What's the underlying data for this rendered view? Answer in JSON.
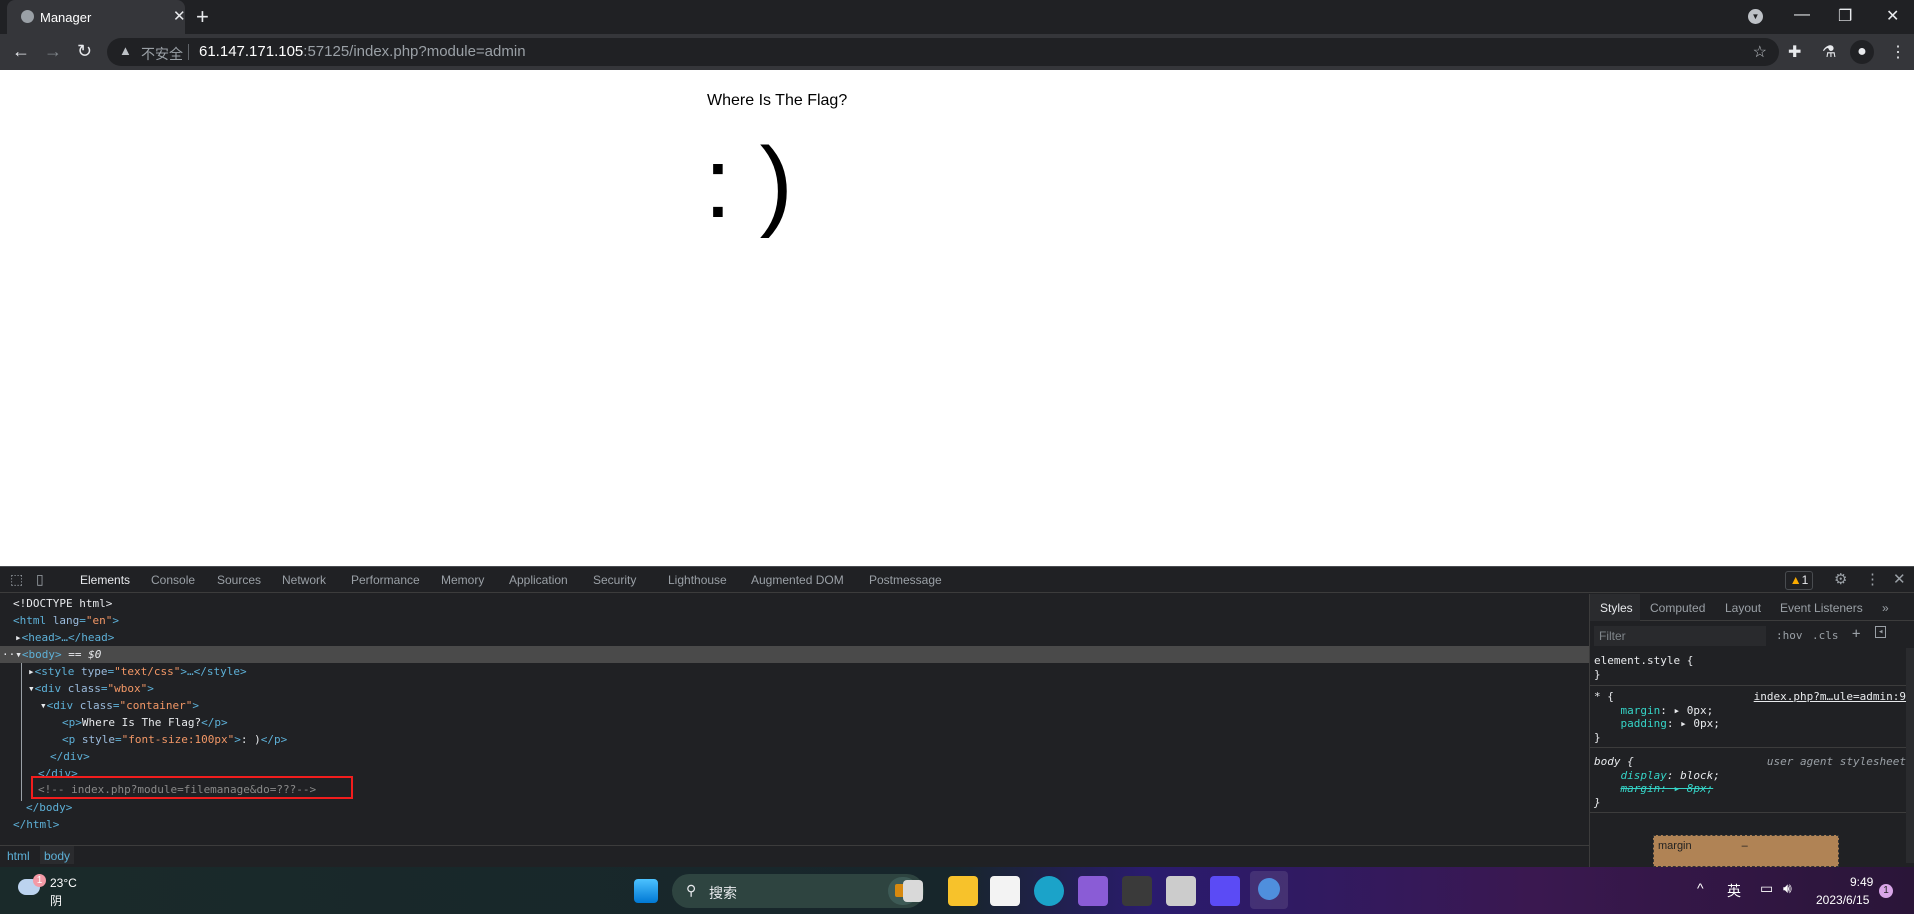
{
  "browser": {
    "tab_title": "Manager",
    "insecure_label": "不安全",
    "url_host": "61.147.171.105",
    "url_rest": ":57125/index.php?module=admin"
  },
  "page": {
    "heading": "Where Is The Flag?",
    "smiley": ": )"
  },
  "devtools": {
    "tabs": [
      "Elements",
      "Console",
      "Sources",
      "Network",
      "Performance",
      "Memory",
      "Application",
      "Security",
      "Lighthouse",
      "Augmented DOM",
      "Postmessage"
    ],
    "warning_count": "1",
    "tree": {
      "doctype": "<!DOCTYPE html>",
      "html_open": "<html",
      "lang_attr": "lang",
      "lang_val": "\"en\"",
      "head": "<head>…</head>",
      "body_open": "<body>",
      "body_marker": " == $0",
      "style": "<style",
      "type_attr": "type",
      "type_val": "\"text/css\"",
      "style_end": ">…</style>",
      "div_wbox": "<div",
      "class_attr": "class",
      "wbox_val": "\"wbox\"",
      "container_val": "\"container\"",
      "p_open": "<p>",
      "p_text": "Where Is The Flag?",
      "p_close": "</p>",
      "p2_style_attr": "style",
      "p2_style_val": "\"font-size:100px\"",
      "p2_text": ": )",
      "div_close": "</div>",
      "comment": "<!-- index.php?module=filemanage&do=???-->",
      "body_close": "</body>",
      "html_close": "</html>"
    },
    "breadcrumbs": [
      "html",
      "body"
    ],
    "styles": {
      "tabs": [
        "Styles",
        "Computed",
        "Layout",
        "Event Listeners",
        "»"
      ],
      "filter_placeholder": "Filter",
      "hov": ":hov",
      "cls": ".cls",
      "element_style": "element.style {",
      "close": "}",
      "star_selector": "* {",
      "star_source": "index.php?m…ule=admin:9",
      "margin_prop": "margin",
      "margin_val": "0px;",
      "padding_prop": "padding",
      "padding_val": "0px;",
      "body_selector": "body {",
      "ua_label": "user agent stylesheet",
      "display_prop": "display",
      "display_val": "block;",
      "body_margin": "margin: ▸ 8px;",
      "box_label": "margin",
      "box_value": "–"
    }
  },
  "taskbar": {
    "weather_temp": "23°C",
    "weather_desc": "阴",
    "weather_badge": "1",
    "search_label": "搜索",
    "ime": "英",
    "time": "9:49",
    "date": "2023/6/15",
    "notif": "1"
  }
}
